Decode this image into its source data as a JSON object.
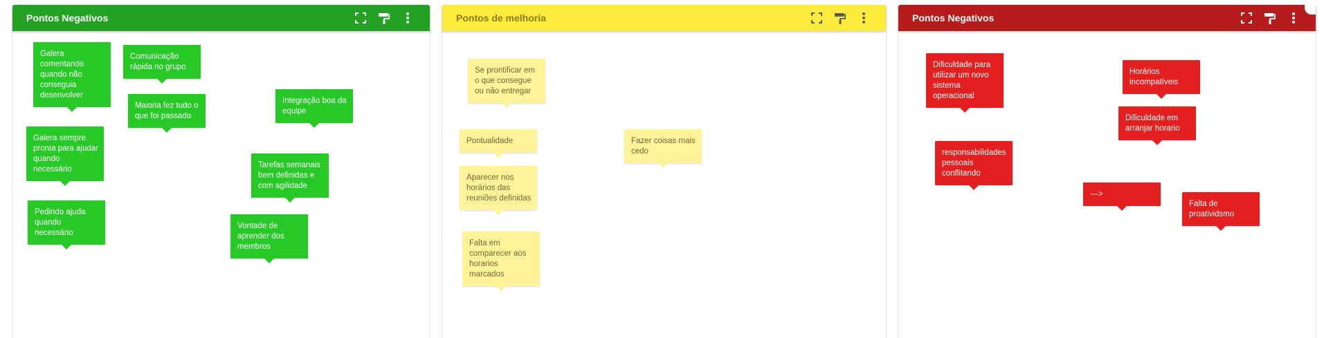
{
  "colors": {
    "green_header": "#23a223",
    "yellow_header": "#ffeb3b",
    "red_header": "#b71c1c",
    "green_note": "#26c926",
    "yellow_note": "#fff39a",
    "red_note": "#e31f1f"
  },
  "panels": [
    {
      "title": "Pontos Negativos",
      "tools": [
        "fullscreen-icon",
        "paint-roller-icon",
        "more-vert-icon"
      ],
      "notes": [
        "Galera comentando quando não conseguia desenvolver",
        "Comunicação rápida no grupo",
        "Maioria fez tudo o que foi passado",
        "Integração boa da equipe",
        "Galera sempre pronta para ajudar quando necessário",
        "Tarefas semanais bem definidas e com agilidade",
        "Pedindo ajuda quando necessário",
        "Vontade de aprender dos membros"
      ]
    },
    {
      "title": "Pontos de melhoria",
      "tools": [
        "fullscreen-icon",
        "paint-roller-icon",
        "more-vert-icon"
      ],
      "notes": [
        "Se prontificar em o que consegue ou não entregar",
        "Pontualidade",
        "Fazer coisas mais cedo",
        "Aparecer nos horários das reuniões definidas",
        "Falta em comparecer aos horarios marcados"
      ]
    },
    {
      "title": "Pontos Negativos",
      "tools": [
        "fullscreen-icon",
        "paint-roller-icon",
        "more-vert-icon"
      ],
      "notes": [
        "Dificuldade para utilizar um novo sistema operacional",
        "Horários incompatíveis",
        "Dificuldade em arranjar horario",
        "responsabilidades pessoais conflitando",
        "--->",
        "Falta de proatividsmo"
      ]
    }
  ]
}
